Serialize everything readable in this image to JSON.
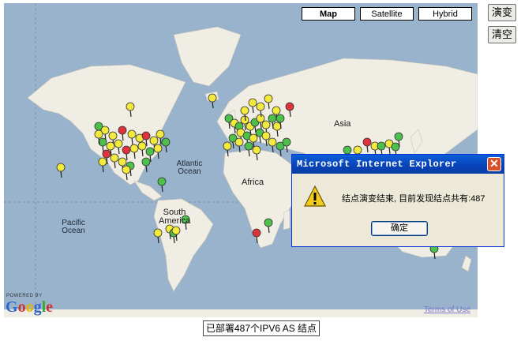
{
  "map": {
    "type_buttons": [
      {
        "label": "Map",
        "selected": true
      },
      {
        "label": "Satellite",
        "selected": false
      },
      {
        "label": "Hybrid",
        "selected": false
      }
    ],
    "labels": {
      "asia": "Asia",
      "africa": "Africa",
      "south_america": "South America",
      "atlantic_ocean": "Atlantic Ocean",
      "pacific_ocean": "Pacific Ocean"
    },
    "powered_by": "POWERED BY",
    "google_logo": "Google",
    "terms": "Terms of Use",
    "colors": {
      "ocean": "#99b3cc",
      "land": "#f0ede4",
      "marker_yellow": "#f2ea3c",
      "marker_green": "#4cc04a",
      "marker_red": "#e0323a"
    }
  },
  "side_buttons": {
    "evolve": "演变",
    "clear": "清空"
  },
  "dialog": {
    "title": "Microsoft Internet Explorer",
    "icon": "warning-icon",
    "message": "结点演变结束, 目前发现结点共有:487",
    "ok_label": "确定"
  },
  "status": {
    "text": "已部署487个IPV6 AS 结点"
  }
}
